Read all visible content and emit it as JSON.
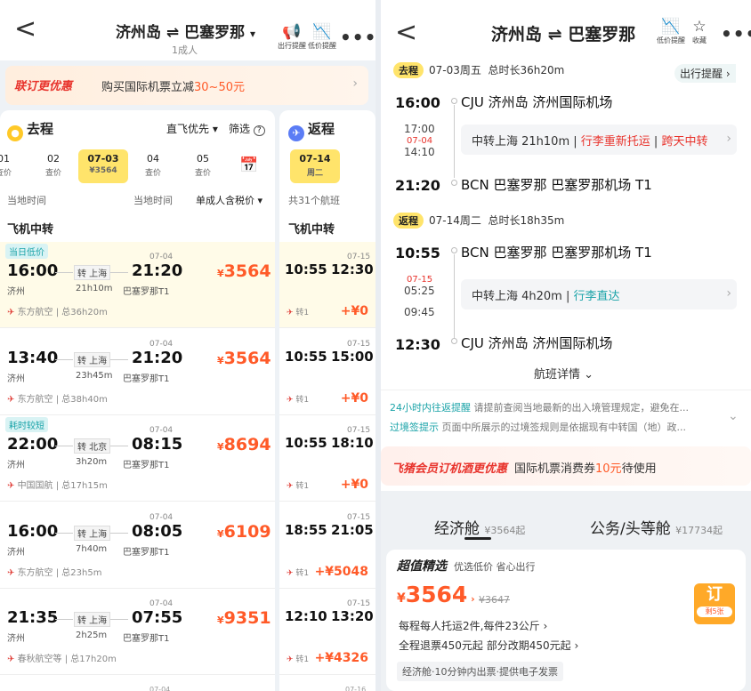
{
  "left": {
    "header": {
      "from": "济州岛",
      "arrow": "⇌",
      "to": "巴塞罗那",
      "dropdown": "▾",
      "passengers": "1成人",
      "alert_label": "出行提醒",
      "lowprice_label": "低价提醒",
      "more": "•••",
      "back": "<"
    },
    "promo": {
      "tag": "联订更优惠",
      "text_prefix": "购买国际机票立减",
      "text_highlight": "30~50元",
      "chev": "›"
    },
    "outbound": {
      "title": "去程",
      "sort": "直飞优先 ▾",
      "filter": "筛选",
      "dates": [
        {
          "d": "01",
          "p": "查价"
        },
        {
          "d": "02",
          "p": "查价"
        },
        {
          "d": "07-03",
          "p": "¥3564"
        },
        {
          "d": "04",
          "p": "查价"
        },
        {
          "d": "05",
          "p": "查价"
        }
      ],
      "col_local1": "当地时间",
      "col_local2": "当地时间",
      "col_price": "单成人含税价 ▾",
      "section": "飞机中转",
      "flights": [
        {
          "tag": "当日低价",
          "dep": "16:00",
          "arr": "21:20",
          "arr_date": "07-04",
          "via": "转 上海",
          "dur": "21h10m",
          "from": "济州",
          "to": "巴塞罗那T1",
          "price": "3564",
          "airline": "东方航空",
          "total": "总36h20m"
        },
        {
          "tag": "",
          "dep": "13:40",
          "arr": "21:20",
          "arr_date": "07-04",
          "via": "转 上海",
          "dur": "23h45m",
          "from": "济州",
          "to": "巴塞罗那T1",
          "price": "3564",
          "airline": "东方航空",
          "total": "总38h40m"
        },
        {
          "tag": "耗时较短",
          "dep": "22:00",
          "arr": "08:15",
          "arr_date": "07-04",
          "via": "转 北京",
          "dur": "3h20m",
          "from": "济州",
          "to": "巴塞罗那T1",
          "price": "8694",
          "airline": "中国国航",
          "total": "总17h15m"
        },
        {
          "tag": "",
          "dep": "16:00",
          "arr": "08:05",
          "arr_date": "07-04",
          "via": "转 上海",
          "dur": "7h40m",
          "from": "济州",
          "to": "巴塞罗那T1",
          "price": "6109",
          "airline": "东方航空",
          "total": "总23h5m"
        },
        {
          "tag": "",
          "dep": "21:35",
          "arr": "07:55",
          "arr_date": "07-04",
          "via": "转 上海",
          "dur": "2h25m",
          "from": "济州",
          "to": "巴塞罗那T1",
          "price": "9351",
          "airline": "春秋航空等",
          "total": "总17h20m"
        }
      ],
      "bottom_date": "07-04"
    },
    "return": {
      "title": "返程",
      "date": "07-14",
      "weekday": "周二",
      "count": "共31个航班",
      "section": "飞机中转",
      "flights": [
        {
          "dep": "10:55",
          "arr": "12:30",
          "arr_date": "07-15",
          "transfer": "转1",
          "price": "+¥0"
        },
        {
          "dep": "10:55",
          "arr": "15:00",
          "arr_date": "07-15",
          "transfer": "转1",
          "price": "+¥0"
        },
        {
          "dep": "10:55",
          "arr": "18:10",
          "arr_date": "07-15",
          "transfer": "转1",
          "price": "+¥0"
        },
        {
          "dep": "18:55",
          "arr": "21:05",
          "arr_date": "07-15",
          "transfer": "转1",
          "price": "+¥5048"
        },
        {
          "dep": "12:10",
          "arr": "13:20",
          "arr_date": "07-15",
          "transfer": "转1",
          "price": "+¥4326"
        }
      ],
      "bottom_date": "07-16"
    }
  },
  "right": {
    "header": {
      "from": "济州岛",
      "arrow": "⇌",
      "to": "巴塞罗那",
      "lowprice_label": "低价提醒",
      "fav_label": "收藏",
      "more": "•••",
      "back": "<"
    },
    "outbound": {
      "tag": "去程",
      "date": "07-03周五",
      "total": "总时长36h20m",
      "alert": "出行提醒 ›",
      "dep_time": "16:00",
      "dep_station": "CJU  济州岛  济州国际机场",
      "mid_t1": "17:00",
      "mid_date": "07-04",
      "mid_t2": "14:10",
      "transfer": "中转上海 21h10m",
      "warn1": "行李重新托运",
      "warn2": "跨天中转",
      "arr_time": "21:20",
      "arr_station": "BCN  巴塞罗那  巴塞罗那机场  T1"
    },
    "return": {
      "tag": "返程",
      "date": "07-14周二",
      "total": "总时长18h35m",
      "dep_time": "10:55",
      "dep_station": "BCN  巴塞罗那  巴塞罗那机场  T1",
      "mid_date": "07-15",
      "mid_t1": "05:25",
      "mid_t2": "09:45",
      "transfer": "中转上海 4h20m",
      "good": "行李直达",
      "arr_time": "12:30",
      "arr_station": "CJU  济州岛  济州国际机场"
    },
    "details": "航班详情",
    "notice1_tag": "24小时内往返提醒",
    "notice1": "请提前查阅当地最新的出入境管理规定，避免在...",
    "notice2_tag": "过境签提示",
    "notice2": "页面中所展示的过境签规则是依据现有中转国（地）政...",
    "vip_tag": "飞猪会员订机酒更优惠",
    "vip_prefix": "国际机票消费券",
    "vip_amount": "10元",
    "vip_suffix": "待使用",
    "cabins": [
      {
        "name": "经济舱",
        "price": "¥3564起"
      },
      {
        "name": "公务/头等舱",
        "price": "¥17734起"
      }
    ],
    "offer": {
      "title": "超值精选",
      "subtitle": "优选低价 省心出行",
      "price": "3564",
      "orig": "¥3647",
      "line1": "每程每人托运2件,每件23公斤 ›",
      "line2": "全程退票450元起 部分改期450元起 ›",
      "tags": "经济舱·10分钟内出票·提供电子发票",
      "book": "订",
      "left": "剩5张"
    }
  }
}
